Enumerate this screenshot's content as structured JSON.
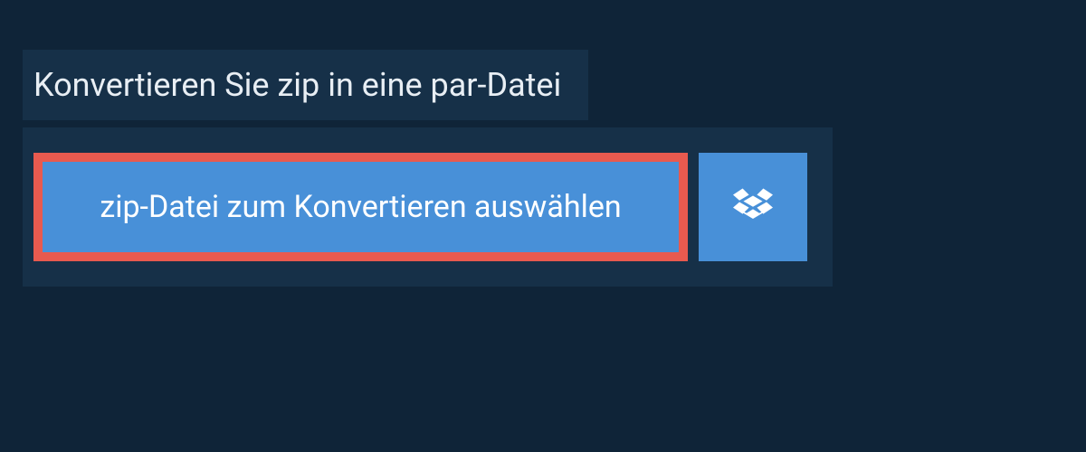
{
  "header": {
    "title": "Konvertieren Sie zip in eine par-Datei"
  },
  "upload": {
    "select_button_label": "zip-Datei zum Konvertieren auswählen",
    "dropbox_icon_name": "dropbox"
  },
  "colors": {
    "page_bg": "#0f2438",
    "panel_bg": "#163048",
    "button_bg": "#4890d8",
    "highlight_border": "#e85a4f",
    "text_light": "#e8eef4"
  }
}
